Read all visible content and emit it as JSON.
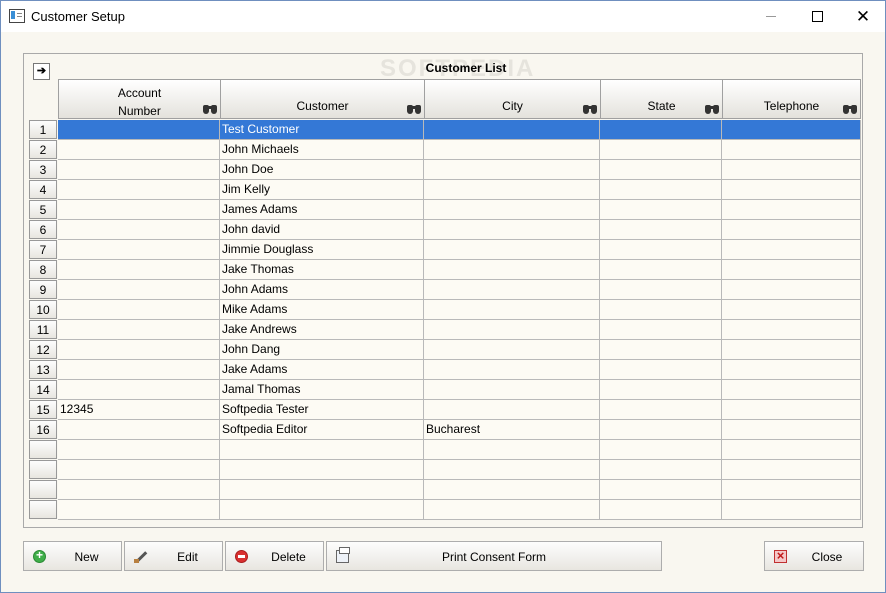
{
  "window": {
    "title": "Customer Setup"
  },
  "list": {
    "title": "Customer List",
    "watermark": "SOFTPEDIA",
    "columns": [
      "Account Number",
      "Customer",
      "City",
      "State",
      "Telephone"
    ],
    "column_account_line1": "Account",
    "column_account_line2": "Number",
    "rows": [
      {
        "n": "1",
        "account": "",
        "customer": "Test Customer",
        "city": "",
        "state": "",
        "telephone": ""
      },
      {
        "n": "2",
        "account": "",
        "customer": "John Michaels",
        "city": "",
        "state": "",
        "telephone": ""
      },
      {
        "n": "3",
        "account": "",
        "customer": "John Doe",
        "city": "",
        "state": "",
        "telephone": ""
      },
      {
        "n": "4",
        "account": "",
        "customer": "Jim Kelly",
        "city": "",
        "state": "",
        "telephone": ""
      },
      {
        "n": "5",
        "account": "",
        "customer": "James Adams",
        "city": "",
        "state": "",
        "telephone": ""
      },
      {
        "n": "6",
        "account": "",
        "customer": "John david",
        "city": "",
        "state": "",
        "telephone": ""
      },
      {
        "n": "7",
        "account": "",
        "customer": "Jimmie Douglass",
        "city": "",
        "state": "",
        "telephone": ""
      },
      {
        "n": "8",
        "account": "",
        "customer": "Jake Thomas",
        "city": "",
        "state": "",
        "telephone": ""
      },
      {
        "n": "9",
        "account": "",
        "customer": "John Adams",
        "city": "",
        "state": "",
        "telephone": ""
      },
      {
        "n": "10",
        "account": "",
        "customer": "Mike Adams",
        "city": "",
        "state": "",
        "telephone": ""
      },
      {
        "n": "11",
        "account": "",
        "customer": "Jake Andrews",
        "city": "",
        "state": "",
        "telephone": ""
      },
      {
        "n": "12",
        "account": "",
        "customer": "John Dang",
        "city": "",
        "state": "",
        "telephone": ""
      },
      {
        "n": "13",
        "account": "",
        "customer": "Jake Adams",
        "city": "",
        "state": "",
        "telephone": ""
      },
      {
        "n": "14",
        "account": "",
        "customer": "Jamal Thomas",
        "city": "",
        "state": "",
        "telephone": ""
      },
      {
        "n": "15",
        "account": "12345",
        "customer": "Softpedia Tester",
        "city": "",
        "state": "",
        "telephone": ""
      },
      {
        "n": "16",
        "account": "",
        "customer": "Softpedia Editor",
        "city": "Bucharest",
        "state": "",
        "telephone": ""
      },
      {
        "n": "",
        "account": "",
        "customer": "",
        "city": "",
        "state": "",
        "telephone": ""
      },
      {
        "n": "",
        "account": "",
        "customer": "",
        "city": "",
        "state": "",
        "telephone": ""
      },
      {
        "n": "",
        "account": "",
        "customer": "",
        "city": "",
        "state": "",
        "telephone": ""
      },
      {
        "n": "",
        "account": "",
        "customer": "",
        "city": "",
        "state": "",
        "telephone": ""
      }
    ],
    "selected_row": 1
  },
  "buttons": {
    "new": "New",
    "edit": "Edit",
    "delete": "Delete",
    "print": "Print Consent Form",
    "close": "Close"
  },
  "colors": {
    "selection": "#3478d6",
    "background": "#f9f7f0"
  },
  "icons": [
    "app-icon",
    "arrow-right-icon",
    "binoculars-icon",
    "plus-circle-icon",
    "brush-icon",
    "minus-circle-icon",
    "printer-icon",
    "close-icon"
  ]
}
